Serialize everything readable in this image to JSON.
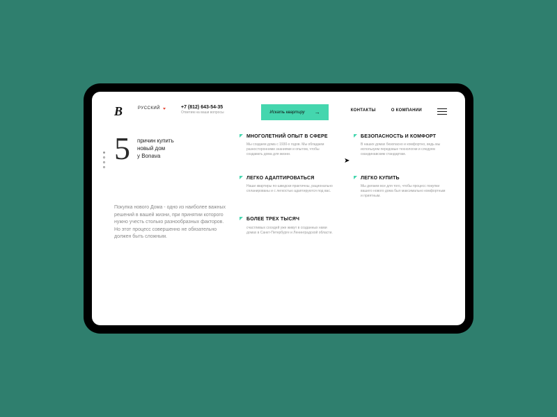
{
  "header": {
    "logo": "B",
    "language": "РУССКИЙ",
    "phone": "+7 (812) 643-54-35",
    "phone_sub": "Ответим на ваши вопросы",
    "cta_label": "Искать квартиру",
    "nav": {
      "contacts": "КОНТАКТЫ",
      "about": "О КОМПАНИИ"
    }
  },
  "headline": {
    "number": "5",
    "line1": "причин купить",
    "line2": "новый дом",
    "line3": "у Bonava"
  },
  "intro": "Покупка нового Дома - одно из наиболее важных решений в вашей жизни, при принятии которого нужно учесть столько разнообразных факторов. Но этот процесс совершенно не обязательно должен быть сложным.",
  "cards": [
    {
      "title": "МНОГОЛЕТНИЙ ОПЫТ В СФЕРЕ",
      "body": "Мы создаем дома с 1930-х годов. Мы обладаем разносторонними знаниями и опытом, чтобы создавать дома для жизни."
    },
    {
      "title": "БЕЗОПАСНОСТЬ И КОМФОРТ",
      "body": "В наших домах безопасно и комфортно, ведь мы используем передовые технологии и следуем скандинавским стандартам."
    },
    {
      "title": "ЛЕГКО АДАПТИРОВАТЬСЯ",
      "body": "Наши квартиры по-шведски практичны, рационально спланированы и с легкостью адаптируются под вас."
    },
    {
      "title": "ЛЕГКО КУПИТЬ",
      "body": "Мы делаем все для того, чтобы процесс покупки вашего нового дома был максимально комфортным и приятным."
    },
    {
      "title": "БОЛЕЕ ТРЕХ ТЫСЯЧ",
      "body": "счастливых соседей уже живут в созданных нами домах в Санкт-Петербурге и Ленинградской области."
    }
  ]
}
